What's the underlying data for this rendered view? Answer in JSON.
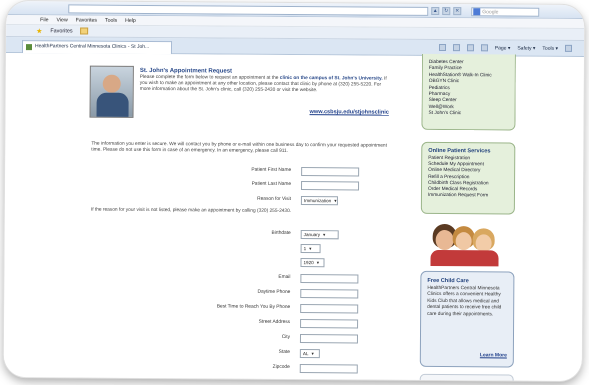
{
  "browser": {
    "address": "                                 ",
    "search_placeholder": "Google",
    "menu": [
      "File",
      "View",
      "Favorites",
      "Tools",
      "Help"
    ],
    "favorites_label": "Favorites",
    "tab_title": "HealthPartners Central Minnesota Clinics - St Joh...",
    "commands": [
      "Page ▾",
      "Safety ▾",
      "Tools ▾"
    ]
  },
  "intro": {
    "title": "St. John's Appointment Request",
    "text_a": "Please complete the form below to request an appointment at the ",
    "text_bold": "clinic on the campus of St. John's University.",
    "text_b": " If you wish to make an appointment at any other location, please contact that clinic by phone at (320) 255-5220. For more information about the St. John's clinic, call (320) 255-2430 or visit the website.",
    "link": "www.csbsju.edu/stjohnsclinic"
  },
  "secure_note": "The information you enter is secure. We will contact you by phone or e-mail within one business day to confirm your requested appointment time. Please do not use this form in case of an emergency. In an emergency, please call 911.",
  "form": {
    "first_name_label": "Patient First Name",
    "last_name_label": "Patient Last Name",
    "reason_label": "Reason for Visit",
    "reason_value": "Immunization",
    "reason_note": "If the reason for your visit is not listed, please make an appointment by calling (320) 255-2430.",
    "birthdate_label": "Birthdate",
    "month_value": "January",
    "day_value": "1",
    "year_value": "1920",
    "email_label": "Email",
    "daytime_phone_label": "Daytime Phone",
    "best_time_label": "Best Time to Reach You By Phone",
    "street_label": "Street Address",
    "city_label": "City",
    "state_label": "State",
    "state_value": "AL",
    "zip_label": "Zipcode"
  },
  "sidebar": {
    "services": [
      "Diabetes Center",
      "Family Practice",
      "HealthStation® Walk-In Clinic",
      "OBGYN Clinic",
      "Pediatrics",
      "Pharmacy",
      "Sleep Center",
      "Well@Work",
      "St John's Clinic"
    ],
    "online_title": "Online Patient Services",
    "online_items": [
      "Patient Registration",
      "Schedule My Appointment",
      "Online Medical Directory",
      "Refill a Prescription",
      "Childbirth Class Registration",
      "Order Medical Records",
      "Immunization Request Form"
    ],
    "childcare_title": "Free Child Care",
    "childcare_text": "HealthPartners Central Minnesota Clinics offers a convenient Healthy Kids Club that allows medical and dental patients to receive free child care during their appointments.",
    "learn_more": "Learn More"
  }
}
